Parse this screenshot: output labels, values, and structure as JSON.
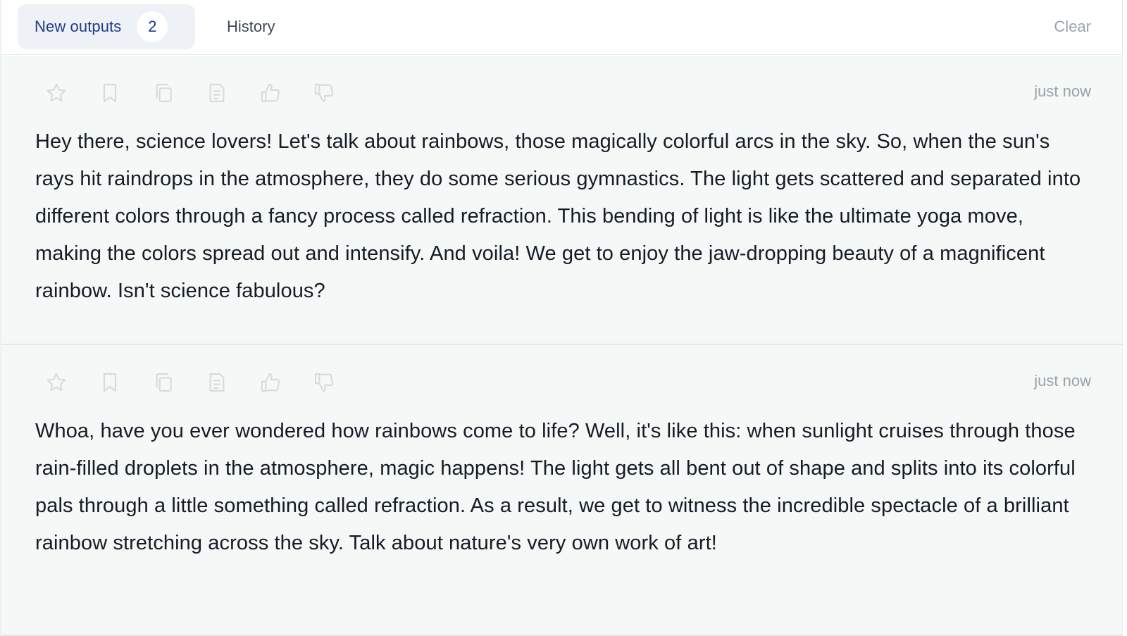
{
  "tabs": {
    "new_outputs_label": "New outputs",
    "new_outputs_count": "2",
    "history_label": "History",
    "clear_label": "Clear"
  },
  "toolbar_icons": [
    "star-icon",
    "bookmark-icon",
    "copy-icon",
    "document-icon",
    "thumbs-up-icon",
    "thumbs-down-icon"
  ],
  "outputs": [
    {
      "timestamp": "just now",
      "text": "Hey there, science lovers! Let's talk about rainbows, those magically colorful arcs in the sky. So, when the sun's rays hit raindrops in the atmosphere, they do some serious gymnastics. The light gets scattered and separated into different colors through a fancy process called refraction. This bending of light is like the ultimate yoga move, making the colors spread out and intensify. And voila! We get to enjoy the jaw-dropping beauty of a magnificent rainbow. Isn't science fabulous?"
    },
    {
      "timestamp": "just now",
      "text": "Whoa, have you ever wondered how rainbows come to life? Well, it's like this: when sunlight cruises through those rain-filled droplets in the atmosphere, magic happens! The light gets all bent out of shape and splits into its colorful pals through a little something called refraction. As a result, we get to witness the incredible spectacle of a brilliant rainbow stretching across the sky. Talk about nature's very own work of art!"
    }
  ],
  "colors": {
    "accent": "#1f3a8a",
    "card_background": "#f4f8f6",
    "icon_stroke": "#d5dcda",
    "muted_text": "#9aa1ab",
    "body_text": "#161b26"
  }
}
